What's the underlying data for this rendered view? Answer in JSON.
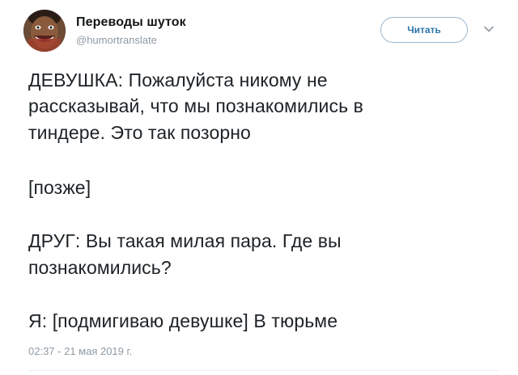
{
  "author": {
    "display_name": "Переводы шуток",
    "handle": "@humortranslate"
  },
  "header": {
    "follow_label": "Читать",
    "menu_icon": "chevron-down-icon"
  },
  "tweet": {
    "lines": [
      "ДЕВУШКА: Пожалуйста никому не",
      "рассказывай, что мы познакомились в",
      "тиндере. Это так позорно",
      "[позже]",
      "ДРУГ: Вы такая милая пара. Где вы",
      "познакомились?",
      "Я: [подмигиваю девушке] В тюрьме"
    ],
    "timestamp": "02:37 - 21 мая 2019 г."
  },
  "colors": {
    "accent": "#2b76ad",
    "muted": "#8f9aa3",
    "text": "#14171a"
  }
}
